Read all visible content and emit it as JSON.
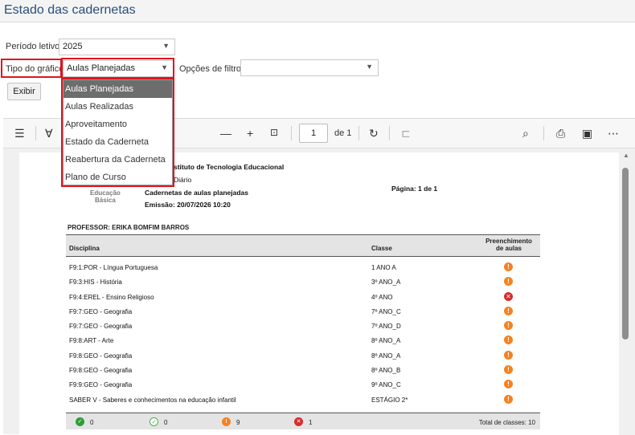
{
  "page": {
    "title": "Estado das cadernetas"
  },
  "filters": {
    "periodo_label": "Período letivo:",
    "periodo_value": "2025",
    "tipo_label": "Tipo do gráfico:",
    "tipo_value": "Aulas Planejadas",
    "opcoes_label": "Opções de filtro:",
    "opcoes_value": "",
    "exibir_label": "Exibir"
  },
  "dropdown": {
    "options": [
      "Aulas Planejadas",
      "Aulas Realizadas",
      "Aproveitamento",
      "Estado da Caderneta",
      "Reabertura da Caderneta",
      "Plano de Curso"
    ],
    "selected_index": 0
  },
  "viewer": {
    "page_number": "1",
    "page_of": "de 1",
    "icons": [
      "list-icon",
      "highlight-icon",
      "zoom-out-icon",
      "zoom-in-icon",
      "fit-width-icon",
      "rotate-icon",
      "two-page-icon",
      "search-icon",
      "print-icon",
      "save-icon",
      "more-icon"
    ]
  },
  "report": {
    "logo_line1": "Educação",
    "logo_line2": "Básica",
    "institute": "stituto de Tecnologia Educacional",
    "system": "Diário",
    "report_title": "Cadernetas de aulas planejadas",
    "emission": "Emissão: 20/07/2026 10:20",
    "pagina": "Página: 1 de 1",
    "professor": "PROFESSOR:  ERIKA BOMFIM BARROS",
    "col_disciplina": "Disciplina",
    "col_classe": "Classe",
    "col_preench_1": "Preenchimento",
    "col_preench_2": "de aulas",
    "rows": [
      {
        "disciplina": "F9:1:POR - Língua Portuguesa",
        "classe": "1 ANO A",
        "status": "warn"
      },
      {
        "disciplina": "F9:3:HIS - História",
        "classe": "3º ANO_A",
        "status": "warn"
      },
      {
        "disciplina": "F9:4:EREL - Ensino Religioso",
        "classe": "4º ANO",
        "status": "err"
      },
      {
        "disciplina": "F9:7:GEO - Geografia",
        "classe": "7º ANO_C",
        "status": "warn"
      },
      {
        "disciplina": "F9:7:GEO - Geografia",
        "classe": "7º ANO_D",
        "status": "warn"
      },
      {
        "disciplina": "F9:8:ART - Arte",
        "classe": "8º ANO_A",
        "status": "warn"
      },
      {
        "disciplina": "F9:8:GEO - Geografia",
        "classe": "8º ANO_A",
        "status": "warn"
      },
      {
        "disciplina": "F9:8:GEO - Geografia",
        "classe": "8º ANO_B",
        "status": "warn"
      },
      {
        "disciplina": "F9:9:GEO - Geografia",
        "classe": "9º ANO_C",
        "status": "warn"
      },
      {
        "disciplina": "SABER V - Saberes e conhecimentos na educação infantil",
        "classe": "ESTÁGIO 2*",
        "status": "warn"
      }
    ],
    "footer": {
      "ok_count": "0",
      "partial_count": "0",
      "warn_count": "9",
      "err_count": "1",
      "total": "Total de classes: 10"
    }
  },
  "colors": {
    "accent_red": "#e1141e",
    "warn": "#f58220",
    "err": "#d62c2c",
    "ok": "#2e9e3a"
  }
}
